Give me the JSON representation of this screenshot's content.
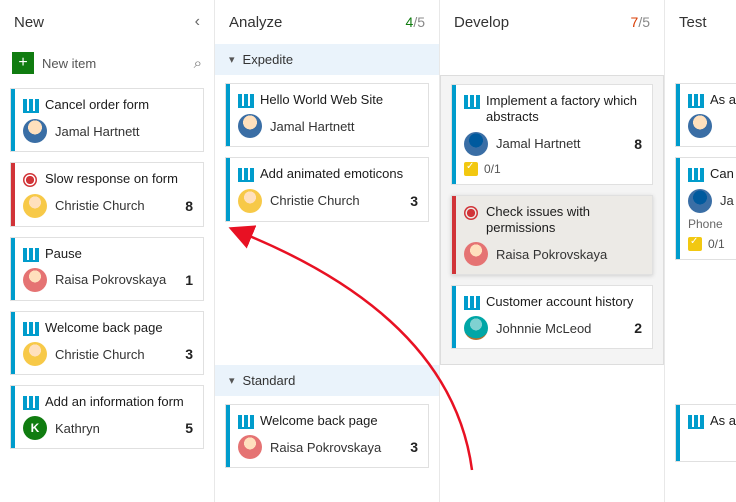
{
  "columns": {
    "new": {
      "title": "New"
    },
    "analyze": {
      "title": "Analyze",
      "wip_current": "4",
      "wip_max": "/5"
    },
    "develop": {
      "title": "Develop",
      "wip_current": "7",
      "wip_max": "/5"
    },
    "test": {
      "title": "Test"
    }
  },
  "newItem": {
    "label": "New item"
  },
  "swimlanes": {
    "expedite": "Expedite",
    "standard": "Standard"
  },
  "newCol": [
    {
      "title": "Cancel order form",
      "assignee": "Jamal Hartnett",
      "count": "",
      "type": "pbi",
      "avatar": "av-jamal"
    },
    {
      "title": "Slow response on form",
      "assignee": "Christie Church",
      "count": "8",
      "type": "bug",
      "avatar": "av-christie"
    },
    {
      "title": "Pause",
      "assignee": "Raisa Pokrovskaya",
      "count": "1",
      "type": "pbi",
      "avatar": "av-raisa"
    },
    {
      "title": "Welcome back page",
      "assignee": "Christie Church",
      "count": "3",
      "type": "pbi",
      "avatar": "av-christie"
    },
    {
      "title": "Add an information form",
      "assignee": "Kathryn",
      "count": "5",
      "type": "pbi",
      "avatar": "av-kathryn"
    }
  ],
  "analyzeExpedite": [
    {
      "title": "Hello World Web Site",
      "assignee": "Jamal Hartnett",
      "count": "",
      "avatar": "av-jamal"
    },
    {
      "title": "Add animated emoticons",
      "assignee": "Christie Church",
      "count": "3",
      "avatar": "av-christie"
    }
  ],
  "analyzeStandard": [
    {
      "title": "Welcome back page",
      "assignee": "Raisa Pokrovskaya",
      "count": "3",
      "avatar": "av-raisa"
    }
  ],
  "developExpedite": [
    {
      "title": "Implement a factory which abstracts",
      "assignee": "Jamal Hartnett",
      "count": "8",
      "avatar": "av-jamal2",
      "tasks": "0/1"
    },
    {
      "title": "Check issues with permissions",
      "assignee": "Raisa Pokrovskaya",
      "count": "",
      "avatar": "av-raisa",
      "type": "bug",
      "highlight": true
    },
    {
      "title": "Customer account history",
      "assignee": "Johnnie McLeod",
      "count": "2",
      "avatar": "av-johnnie"
    }
  ],
  "testExpedite": [
    {
      "title": "As a framew",
      "assignee": "",
      "count": ""
    },
    {
      "title": "Can",
      "assignee": "Ja",
      "tag": "Phone",
      "tasks": "0/1"
    }
  ],
  "testStandard": [
    {
      "title": "As a numbe",
      "assignee": ""
    }
  ]
}
